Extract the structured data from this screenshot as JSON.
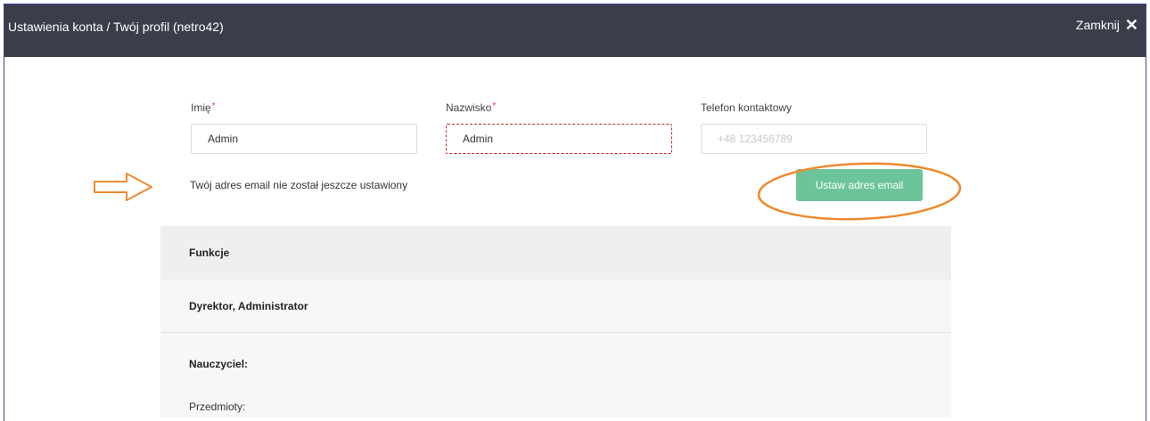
{
  "header": {
    "title": "Ustawienia konta / Twój profil (netro42)",
    "close_label": "Zamknij",
    "close_glyph": "✕"
  },
  "form": {
    "first_name": {
      "label": "Imię",
      "required_mark": "*",
      "value": "Admin"
    },
    "last_name": {
      "label": "Nazwisko",
      "required_mark": "*",
      "value": "Admin"
    },
    "phone": {
      "label": "Telefon kontaktowy",
      "value": "",
      "placeholder": "+48 123456789"
    }
  },
  "email": {
    "note": "Twój adres email nie został jeszcze ustawiony",
    "button_label": "Ustaw adres email"
  },
  "roles": {
    "header": "Funkcje",
    "value": "Dyrektor, Administrator",
    "teacher_label": "Nauczyciel:",
    "subjects_label": "Przedmioty:"
  },
  "colors": {
    "topbar": "#3b3e4a",
    "button": "#6cc59a",
    "annotation": "#ee8a2e",
    "required": "#e53935"
  }
}
